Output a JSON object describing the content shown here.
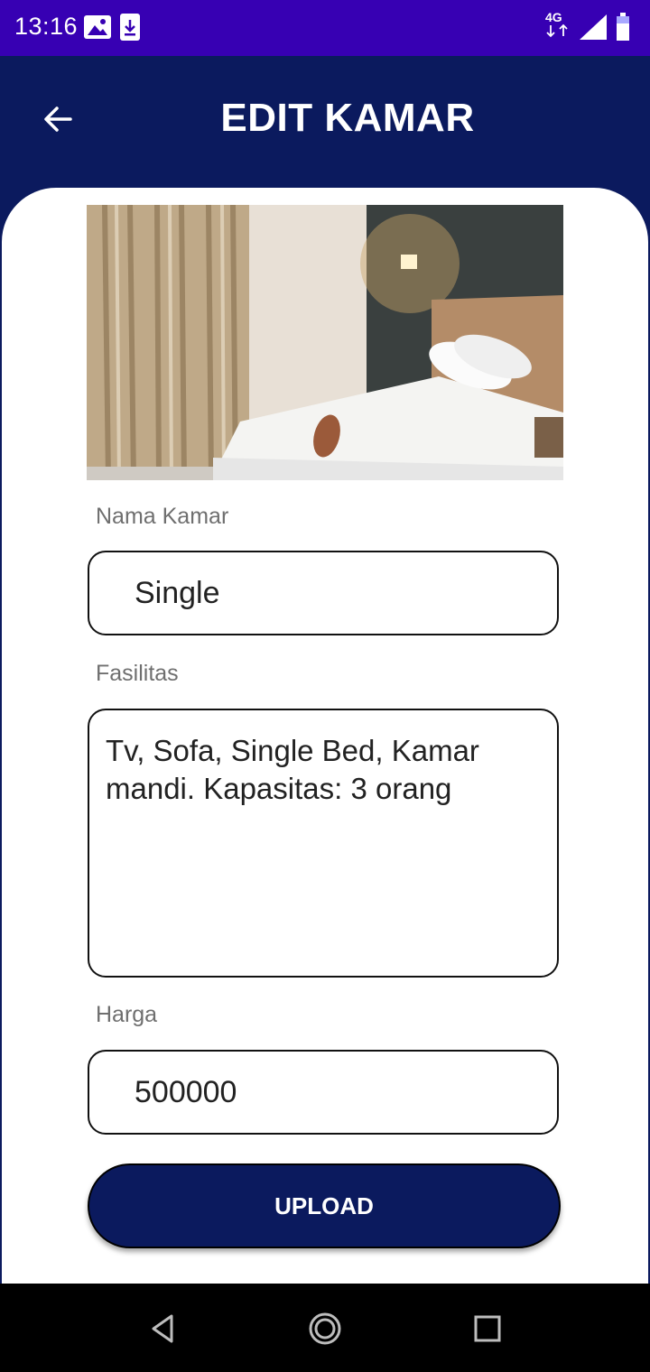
{
  "status_bar": {
    "time": "13:16",
    "network": "4G",
    "icons": [
      "gallery-icon",
      "download-icon",
      "signal-icon",
      "battery-icon"
    ]
  },
  "header": {
    "title": "EDIT KAMAR",
    "back_icon": "arrow-left-icon"
  },
  "form": {
    "image_desc": "hotel-room-photo",
    "nama_kamar": {
      "label": "Nama Kamar",
      "value": "Single"
    },
    "fasilitas": {
      "label": "Fasilitas",
      "value": "Tv, Sofa, Single Bed, Kamar mandi. Kapasitas: 3 orang"
    },
    "harga": {
      "label": "Harga",
      "value": "500000"
    },
    "upload_label": "UPLOAD"
  },
  "nav_bar": {
    "icons": [
      "back-triangle-icon",
      "home-circle-icon",
      "recents-square-icon"
    ]
  },
  "colors": {
    "status_bar": "#3700b3",
    "primary": "#0b1a5e",
    "label": "#6f6f6f"
  }
}
